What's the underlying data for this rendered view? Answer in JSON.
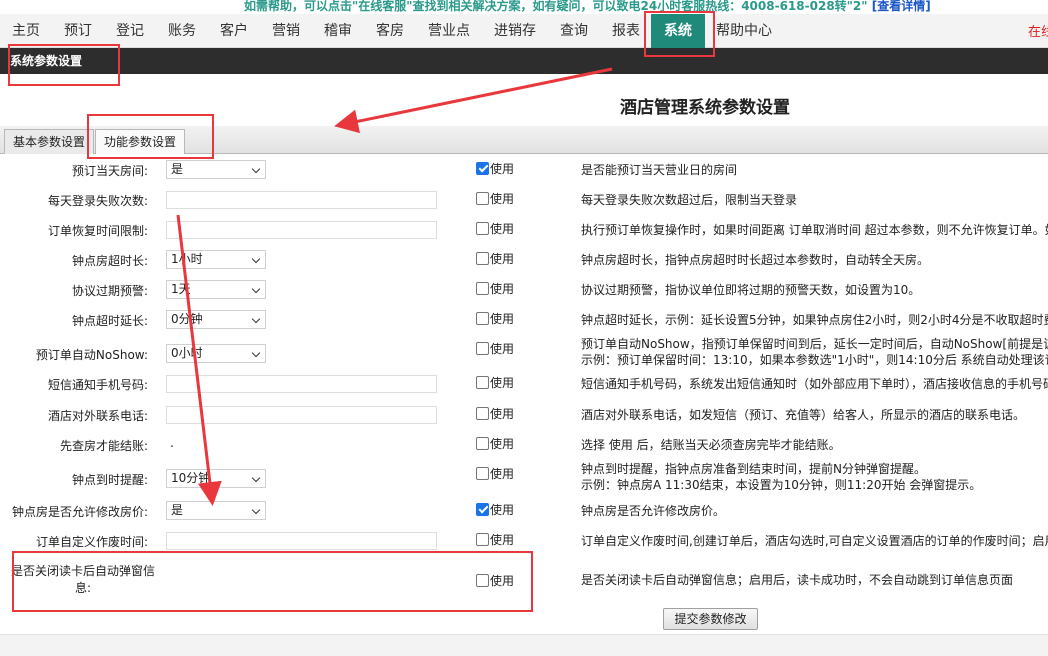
{
  "banner": {
    "text": "如需帮助，可以点击\"在线客服\"查找到相关解决方案，如有疑问，可以致电24小时客服热线：4008-618-028转\"2\"",
    "link": "[查看详情]"
  },
  "nav": {
    "items": [
      "主页",
      "预订",
      "登记",
      "账务",
      "客户",
      "营销",
      "稽审",
      "客房",
      "营业点",
      "进销存",
      "查询",
      "报表",
      "系统",
      "帮助中心"
    ],
    "active": "系统",
    "right_text": "在线"
  },
  "titlebar": {
    "text": "系统参数设置"
  },
  "page_title": "酒店管理系统参数设置",
  "tabs": [
    "基本参数设置",
    "功能参数设置"
  ],
  "checkbox_label": "使用",
  "rows": [
    {
      "label": "预订当天房间:",
      "control": "select",
      "value": "是",
      "checked": true,
      "desc": [
        "是否能预订当天营业日的房间"
      ]
    },
    {
      "label": "每天登录失败次数:",
      "control": "text",
      "value": "",
      "checked": false,
      "desc": [
        "每天登录失败次数超过后，限制当天登录"
      ]
    },
    {
      "label": "订单恢复时间限制:",
      "control": "text",
      "value": "",
      "checked": false,
      "desc": [
        "执行预订单恢复操作时，如果时间距离 订单取消时间 超过本参数，则不允许恢复订单。如"
      ]
    },
    {
      "label": "钟点房超时长:",
      "control": "select",
      "value": "1小时",
      "checked": false,
      "desc": [
        "钟点房超时长，指钟点房超时时长超过本参数时，自动转全天房。"
      ]
    },
    {
      "label": "协议过期预警:",
      "control": "select",
      "value": "1天",
      "checked": false,
      "desc": [
        "协议过期预警，指协议单位即将过期的预警天数，如设置为10。"
      ]
    },
    {
      "label": "钟点超时延长:",
      "control": "select",
      "value": "0分钟",
      "checked": false,
      "desc": [
        "钟点超时延长，示例：延长设置5分钟，如果钟点房住2小时，则2小时4分是不收取超时费"
      ]
    },
    {
      "label": "预订单自动NoShow:",
      "control": "select",
      "value": "0小时",
      "checked": false,
      "desc": [
        "预订单自动NoShow，指预订单保留时间到后，延长一定时间后，自动NoShow[前提是该订",
        "示例：预订单保留时间：13:10，如果本参数选\"1小时\"，则14:10分后 系统自动处理该订单"
      ]
    },
    {
      "label": "短信通知手机号码:",
      "control": "text",
      "value": "",
      "checked": false,
      "desc": [
        "短信通知手机号码，系统发出短信通知时（如外部应用下单时），酒店接收信息的手机号码"
      ]
    },
    {
      "label": "酒店对外联系电话:",
      "control": "text",
      "value": "",
      "checked": false,
      "desc": [
        "酒店对外联系电话，如发短信（预订、充值等）给客人，所显示的酒店的联系电话。"
      ]
    },
    {
      "label": "先查房才能结账:",
      "control": "dot",
      "value": ".",
      "checked": false,
      "desc": [
        "选择 使用 后，结账当天必须查房完毕才能结账。"
      ]
    },
    {
      "label": "钟点到时提醒:",
      "control": "select",
      "value": "10分钟",
      "checked": false,
      "desc": [
        "钟点到时提醒，指钟点房准备到结束时间，提前N分钟弹窗提醒。",
        "示例：钟点房A 11:30结束，本设置为10分钟，则11:20开始 会弹窗提示。"
      ]
    },
    {
      "label": "钟点房是否允许修改房价:",
      "control": "select",
      "value": "是",
      "checked": true,
      "desc": [
        "钟点房是否允许修改房价。"
      ]
    },
    {
      "label": "订单自定义作废时间:",
      "control": "text",
      "value": "",
      "checked": false,
      "desc": [
        "订单自定义作废时间,创建订单后，酒店勾选时,可自定义设置酒店的订单的作废时间；启用"
      ]
    },
    {
      "label": "是否关闭读卡后自动弹窗信息:",
      "control": "none",
      "value": "",
      "checked": false,
      "desc": [
        "是否关闭读卡后自动弹窗信息；启用后，读卡成功时，不会自动跳到订单信息页面"
      ]
    }
  ],
  "submit_label": "提交参数修改",
  "annotation_color": "#e8383d"
}
